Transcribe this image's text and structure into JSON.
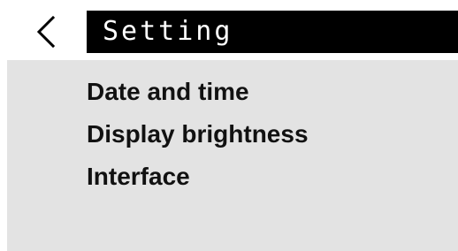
{
  "header": {
    "back_icon": "chevron-left-icon",
    "title": "Setting"
  },
  "menu": {
    "items": [
      {
        "label": "Date and time"
      },
      {
        "label": "Display brightness"
      },
      {
        "label": "Interface"
      }
    ]
  },
  "colors": {
    "title_bar_background": "#000000",
    "title_text": "#ffffff",
    "panel_background": "#e3e3e3",
    "menu_text": "#111111"
  }
}
